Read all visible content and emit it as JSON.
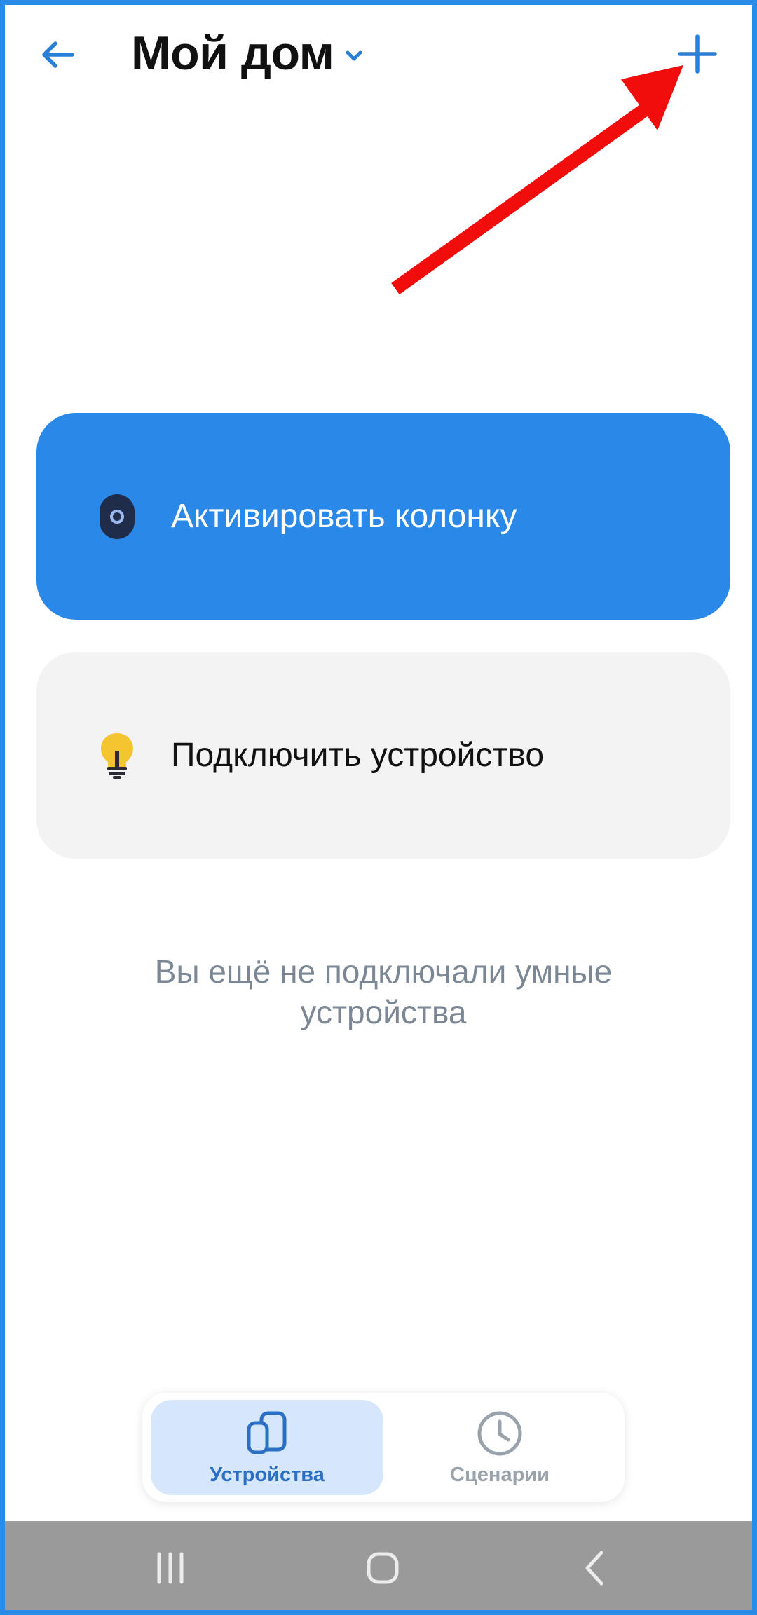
{
  "header": {
    "title": "Мой дом",
    "back_icon": "arrow-left-icon",
    "chevron_icon": "chevron-down-icon",
    "add_icon": "plus-icon"
  },
  "actions": {
    "activate_speaker": {
      "label": "Активировать колонку",
      "icon": "speaker-icon"
    },
    "connect_device": {
      "label": "Подключить устройство",
      "icon": "lightbulb-icon"
    }
  },
  "empty_state": {
    "text": "Вы ещё не подключали умные устройства"
  },
  "tabs": [
    {
      "label": "Устройства",
      "icon": "devices-icon",
      "active": true
    },
    {
      "label": "Сценарии",
      "icon": "clock-icon",
      "active": false
    }
  ],
  "system_nav": {
    "recents_icon": "recents-icon",
    "home_icon": "home-icon",
    "back_icon": "back-chevron-icon"
  },
  "colors": {
    "accent": "#2a89e8",
    "annotation": "#f20d0d",
    "card_gray": "#f3f3f3",
    "tab_active_bg": "#d6e7fb",
    "muted_text": "#7b8794",
    "nav_bar": "#9a9a9a"
  }
}
